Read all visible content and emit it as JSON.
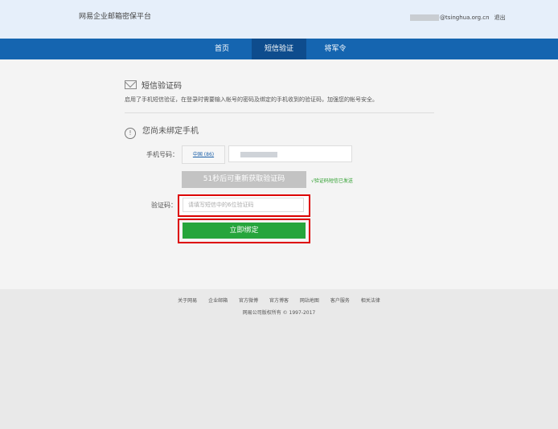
{
  "header": {
    "brand": "网易企业邮箱密保平台",
    "user_domain": "@tsinghua.org.cn",
    "logout": "退出"
  },
  "nav": {
    "items": [
      {
        "label": "首页"
      },
      {
        "label": "短信验证"
      },
      {
        "label": "将军令"
      }
    ],
    "active": "短信验证"
  },
  "section": {
    "title": "短信验证码",
    "description": "启用了手机短信验证，在登录时需要输入帐号的密码及绑定的手机收到的验证码，加强您的帐号安全。",
    "notice": "您尚未绑定手机"
  },
  "form": {
    "phone_label": "手机号码：",
    "country_code": "中国 (86)",
    "resend_label": "51秒后可重新获取验证码",
    "sent_hint": "√验证码短信已发送",
    "code_label": "验证码：",
    "code_placeholder": "请填写短信中的6位验证码",
    "bind_label": "立即绑定"
  },
  "footer": {
    "links": [
      "关于网易",
      "企业邮箱",
      "官方微博",
      "官方博客",
      "网站地图",
      "客户服务",
      "相关法律"
    ],
    "copyright": "网易公司版权所有 © 1997-2017"
  },
  "colors": {
    "nav": "#1565b0",
    "nav_active": "#0e4c8d",
    "primary_button": "#26a53c",
    "highlight_border": "#dd0000",
    "sent_hint": "#2c9e2c"
  }
}
